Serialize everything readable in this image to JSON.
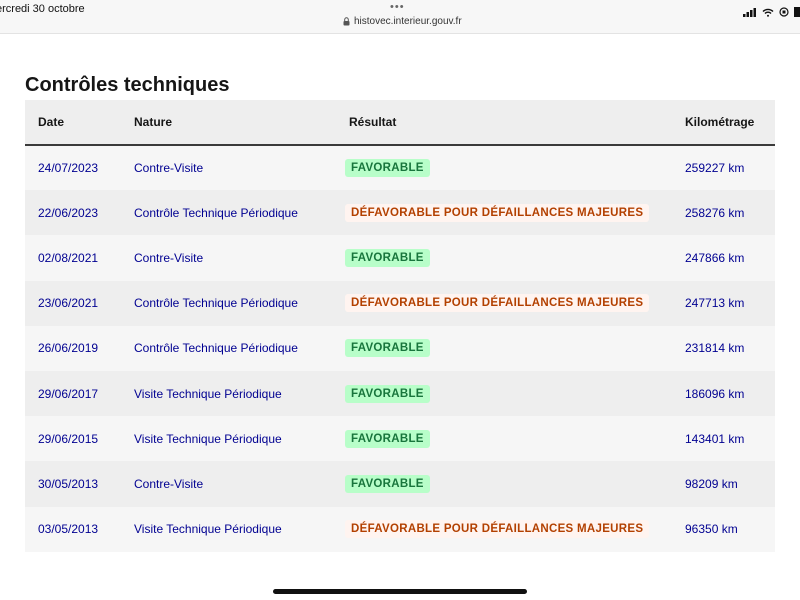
{
  "status_bar": {
    "date": "ercredi 30 octobre",
    "url": "histovec.interieur.gouv.fr",
    "dots": "•••"
  },
  "page": {
    "title": "Contrôles techniques"
  },
  "table": {
    "headers": {
      "date": "Date",
      "nature": "Nature",
      "result": "Résultat",
      "mileage": "Kilométrage"
    },
    "rows": [
      {
        "date": "24/07/2023",
        "nature": "Contre-Visite",
        "result": "FAVORABLE",
        "status": "ok",
        "mileage": "259227 km"
      },
      {
        "date": "22/06/2023",
        "nature": "Contrôle Technique Périodique",
        "result": "DÉFAVORABLE POUR DÉFAILLANCES MAJEURES",
        "status": "ko",
        "mileage": "258276 km"
      },
      {
        "date": "02/08/2021",
        "nature": "Contre-Visite",
        "result": "FAVORABLE",
        "status": "ok",
        "mileage": "247866 km"
      },
      {
        "date": "23/06/2021",
        "nature": "Contrôle Technique Périodique",
        "result": "DÉFAVORABLE POUR DÉFAILLANCES MAJEURES",
        "status": "ko",
        "mileage": "247713 km"
      },
      {
        "date": "26/06/2019",
        "nature": "Contrôle Technique Périodique",
        "result": "FAVORABLE",
        "status": "ok",
        "mileage": "231814 km"
      },
      {
        "date": "29/06/2017",
        "nature": "Visite Technique Périodique",
        "result": "FAVORABLE",
        "status": "ok",
        "mileage": "186096 km"
      },
      {
        "date": "29/06/2015",
        "nature": "Visite Technique Périodique",
        "result": "FAVORABLE",
        "status": "ok",
        "mileage": "143401 km"
      },
      {
        "date": "30/05/2013",
        "nature": "Contre-Visite",
        "result": "FAVORABLE",
        "status": "ok",
        "mileage": "98209 km"
      },
      {
        "date": "03/05/2013",
        "nature": "Visite Technique Périodique",
        "result": "DÉFAVORABLE POUR DÉFAILLANCES MAJEURES",
        "status": "ko",
        "mileage": "96350 km"
      }
    ]
  },
  "colors": {
    "link": "#000091",
    "favorable_text": "#18753c",
    "favorable_bg": "#b8fec9",
    "defavorable_text": "#b34000",
    "defavorable_bg": "#fff4f0"
  },
  "icons": [
    "lock-icon",
    "signal-icon",
    "wifi-icon",
    "orientation-lock-icon"
  ]
}
